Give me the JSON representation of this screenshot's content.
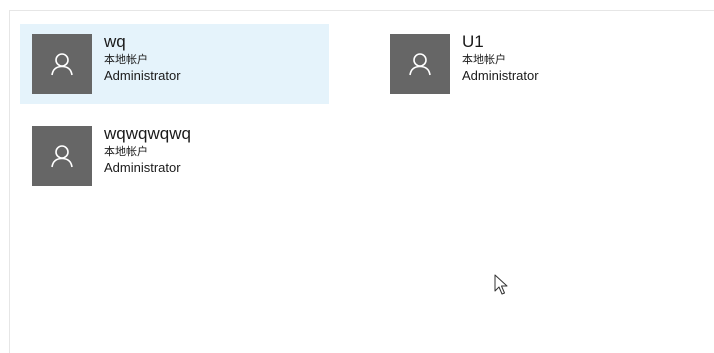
{
  "users": [
    {
      "name": "wq",
      "account_type": "本地帐户",
      "role": "Administrator",
      "selected": true,
      "icon": "user-icon"
    },
    {
      "name": "U1",
      "account_type": "本地帐户",
      "role": "Administrator",
      "selected": false,
      "icon": "user-icon"
    },
    {
      "name": "wqwqwqwq",
      "account_type": "本地帐户",
      "role": "Administrator",
      "selected": false,
      "icon": "user-icon"
    }
  ],
  "colors": {
    "selected_background": "#e5f3fb",
    "avatar_background": "#666666",
    "text": "#1a1a1a"
  },
  "pointer": "arrow-cursor"
}
